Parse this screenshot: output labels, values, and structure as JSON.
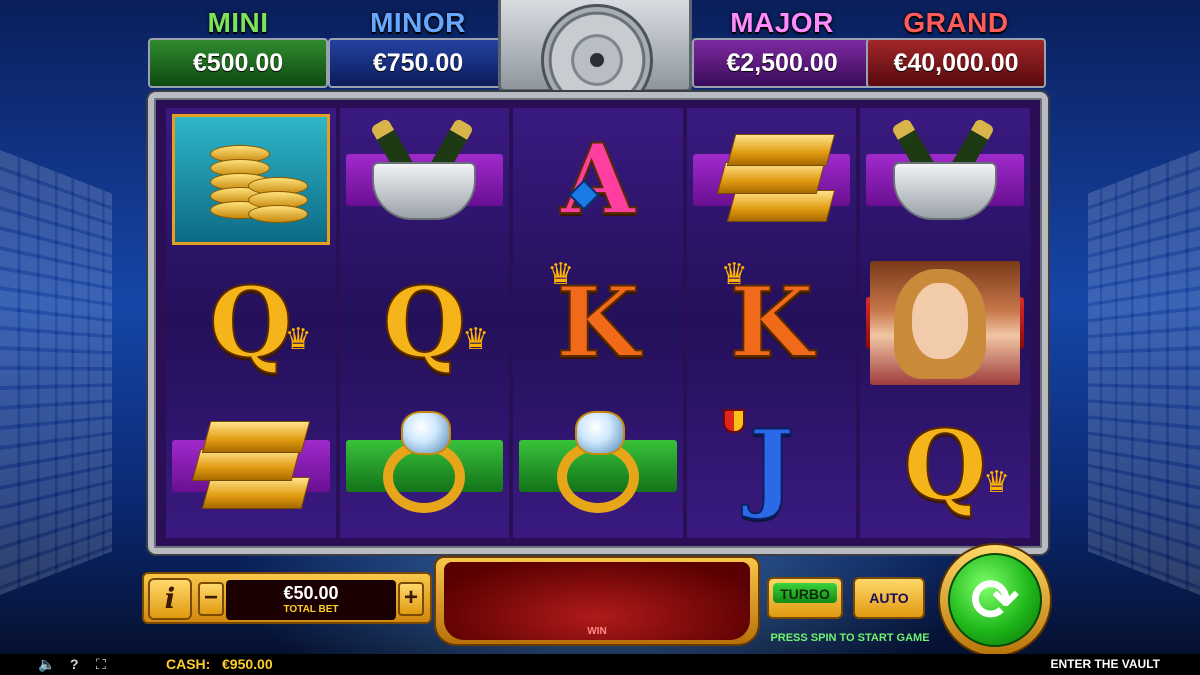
{
  "jackpots": [
    {
      "name": "MINI",
      "amount": "€500.00",
      "color": "#7fe35a"
    },
    {
      "name": "MINOR",
      "amount": "€750.00",
      "color": "#67a8ff"
    },
    {
      "name": "MAJOR",
      "amount": "€2,500.00",
      "color": "#ff8cff"
    },
    {
      "name": "GRAND",
      "amount": "€40,000.00",
      "color": "#ff5b5b"
    }
  ],
  "reels": [
    [
      "gold-coins",
      "Q",
      "gold-bars"
    ],
    [
      "champagne-bucket",
      "Q",
      "diamond-ring"
    ],
    [
      "A",
      "K",
      "diamond-ring"
    ],
    [
      "gold-bars",
      "K",
      "J"
    ],
    [
      "champagne-bucket",
      "woman",
      "Q"
    ]
  ],
  "symbols": {
    "q": "Q",
    "k": "K",
    "a": "A",
    "j": "J"
  },
  "controls": {
    "info_label": "i",
    "minus_label": "−",
    "plus_label": "+",
    "bet_value": "€50.00",
    "bet_label": "TOTAL BET",
    "win_label": "WIN",
    "turbo_label": "TURBO",
    "auto_label": "AUTO",
    "press_msg": "PRESS SPIN TO START GAME",
    "spin_icon": "⟳"
  },
  "footer": {
    "cash_label": "CASH:",
    "cash_value": "€950.00",
    "game_name": "ENTER THE VAULT",
    "sound_icon": "🔈",
    "help_icon": "?",
    "fullscreen_icon": "⛶"
  }
}
